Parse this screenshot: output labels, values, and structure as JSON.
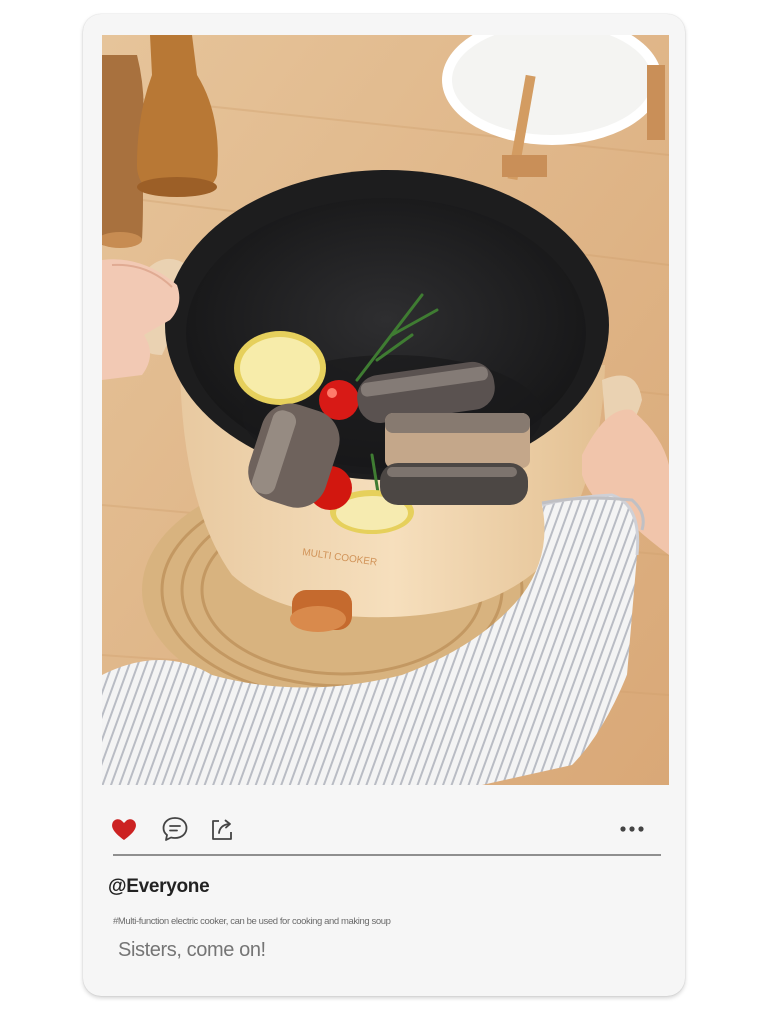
{
  "post": {
    "image_alt": "Multi-function electric cooker with fish, lemon and tomatoes",
    "handle": "@Everyone",
    "tagline": "#Multi-function electric cooker, can be used for cooking and making soup",
    "caption": "Sisters, come on!"
  },
  "actions": {
    "like_icon": "heart-icon",
    "comment_icon": "comment-icon",
    "share_icon": "share-icon",
    "more_icon": "more-dots-icon"
  },
  "colors": {
    "card_bg": "#f6f6f6",
    "heart": "#cc2222",
    "icon": "#444444",
    "divider": "#8f8f8f"
  }
}
